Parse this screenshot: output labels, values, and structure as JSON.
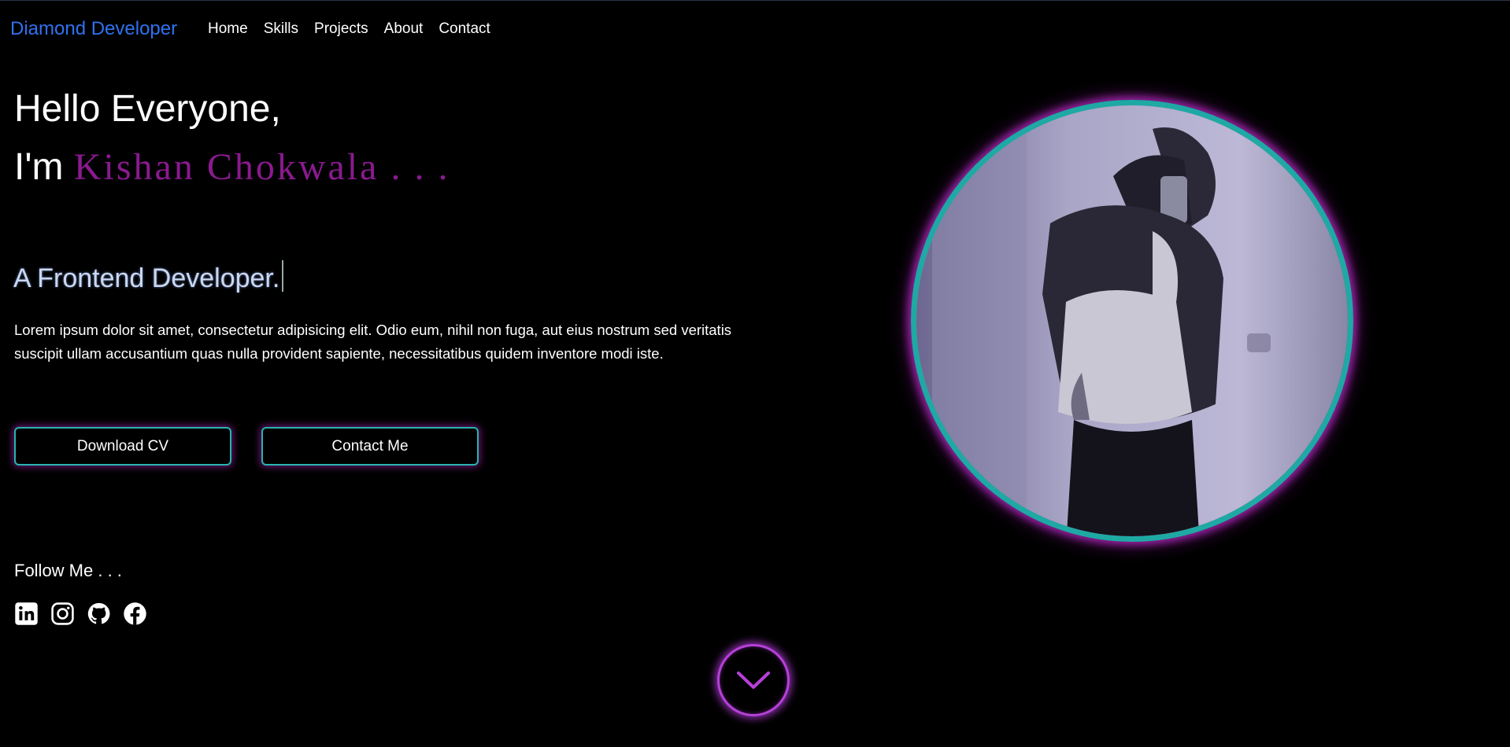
{
  "nav": {
    "brand": "Diamond Developer",
    "links": [
      "Home",
      "Skills",
      "Projects",
      "About",
      "Contact"
    ]
  },
  "hero": {
    "greeting": "Hello Everyone,",
    "im_prefix": "I'm",
    "name": "Kishan Chokwala . . .",
    "role": "A Frontend Developer.",
    "description": "Lorem ipsum dolor sit amet, consectetur adipisicing elit. Odio eum, nihil non fuga, aut eius nostrum sed veritatis suscipit ullam accusantium quas nulla provident sapiente, necessitatibus quidem inventore modi iste.",
    "buttons": {
      "download_cv": "Download CV",
      "contact_me": "Contact Me"
    }
  },
  "follow": {
    "title": "Follow Me . . .",
    "icons": [
      "linkedin-icon",
      "instagram-icon",
      "github-icon",
      "facebook-icon"
    ]
  },
  "profile_photo": {
    "ring_color": "#1fa9a4",
    "glow_color": "#b428be"
  },
  "scroll_down": {
    "icon": "chevron-down-icon"
  },
  "colors": {
    "brand": "#2f72f0",
    "name": "#8a1a8f",
    "button_border": "#27b4b0",
    "accent_glow": "#b640d9"
  }
}
